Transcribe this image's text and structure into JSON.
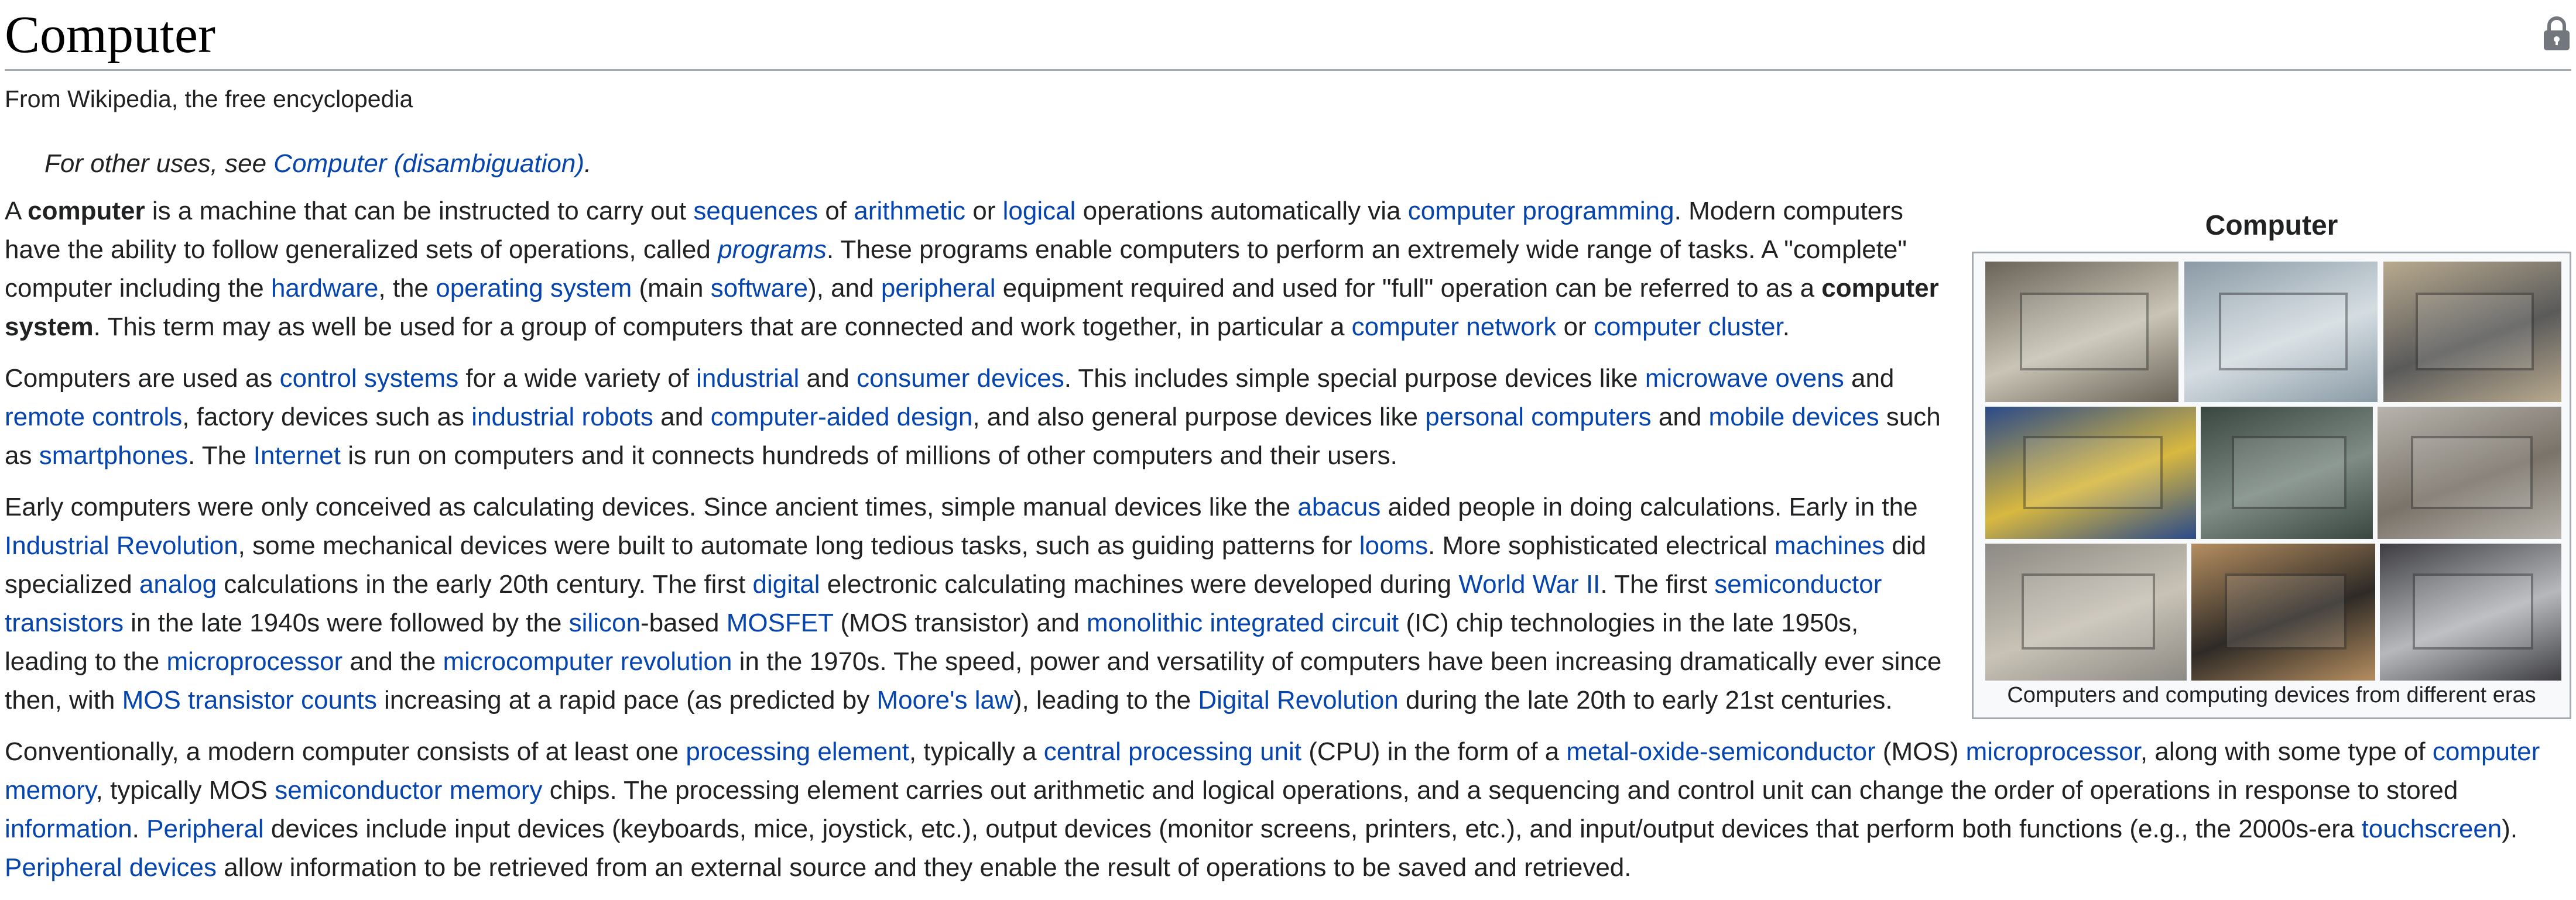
{
  "article": {
    "title": "Computer",
    "tagline": "From Wikipedia, the free encyclopedia",
    "hatnote": {
      "prefix": "For other uses, see ",
      "link": "Computer (disambiguation)",
      "suffix": "."
    }
  },
  "paragraphs": [
    {
      "wide": false,
      "segments": [
        {
          "t": "A ",
          "k": "text"
        },
        {
          "t": "computer",
          "k": "bold"
        },
        {
          "t": " is a machine that can be instructed to carry out ",
          "k": "text"
        },
        {
          "t": "sequences",
          "k": "link"
        },
        {
          "t": " of ",
          "k": "text"
        },
        {
          "t": "arithmetic",
          "k": "link"
        },
        {
          "t": " or ",
          "k": "text"
        },
        {
          "t": "logical",
          "k": "link"
        },
        {
          "t": " operations automatically via ",
          "k": "text"
        },
        {
          "t": "computer programming",
          "k": "link"
        },
        {
          "t": ". Modern computers have the ability to follow generalized sets of operations, called ",
          "k": "text"
        },
        {
          "t": "programs",
          "k": "italic-link"
        },
        {
          "t": ". These programs enable computers to perform an extremely wide range of tasks. A \"complete\" computer including the ",
          "k": "text"
        },
        {
          "t": "hardware",
          "k": "link"
        },
        {
          "t": ", the ",
          "k": "text"
        },
        {
          "t": "operating system",
          "k": "link"
        },
        {
          "t": " (main ",
          "k": "text"
        },
        {
          "t": "software",
          "k": "link"
        },
        {
          "t": "), and ",
          "k": "text"
        },
        {
          "t": "peripheral",
          "k": "link"
        },
        {
          "t": " equipment required and used for \"full\" operation can be referred to as a ",
          "k": "text"
        },
        {
          "t": "computer system",
          "k": "bold"
        },
        {
          "t": ". This term may as well be used for a group of computers that are connected and work together, in particular a ",
          "k": "text"
        },
        {
          "t": "computer network",
          "k": "link"
        },
        {
          "t": " or ",
          "k": "text"
        },
        {
          "t": "computer cluster",
          "k": "link"
        },
        {
          "t": ".",
          "k": "text"
        }
      ]
    },
    {
      "wide": false,
      "segments": [
        {
          "t": "Computers are used as ",
          "k": "text"
        },
        {
          "t": "control systems",
          "k": "link"
        },
        {
          "t": " for a wide variety of ",
          "k": "text"
        },
        {
          "t": "industrial",
          "k": "link"
        },
        {
          "t": " and ",
          "k": "text"
        },
        {
          "t": "consumer devices",
          "k": "link"
        },
        {
          "t": ". This includes simple special purpose devices like ",
          "k": "text"
        },
        {
          "t": "microwave ovens",
          "k": "link"
        },
        {
          "t": " and ",
          "k": "text"
        },
        {
          "t": "remote controls",
          "k": "link"
        },
        {
          "t": ", factory devices such as ",
          "k": "text"
        },
        {
          "t": "industrial robots",
          "k": "link"
        },
        {
          "t": " and ",
          "k": "text"
        },
        {
          "t": "computer-aided design",
          "k": "link"
        },
        {
          "t": ", and also general purpose devices like ",
          "k": "text"
        },
        {
          "t": "personal computers",
          "k": "link"
        },
        {
          "t": " and ",
          "k": "text"
        },
        {
          "t": "mobile devices",
          "k": "link"
        },
        {
          "t": " such as ",
          "k": "text"
        },
        {
          "t": "smartphones",
          "k": "link"
        },
        {
          "t": ". The ",
          "k": "text"
        },
        {
          "t": "Internet",
          "k": "link"
        },
        {
          "t": " is run on computers and it connects hundreds of millions of other computers and their users.",
          "k": "text"
        }
      ]
    },
    {
      "wide": false,
      "segments": [
        {
          "t": "Early computers were only conceived as calculating devices. Since ancient times, simple manual devices like the ",
          "k": "text"
        },
        {
          "t": "abacus",
          "k": "link"
        },
        {
          "t": " aided people in doing calculations. Early in the ",
          "k": "text"
        },
        {
          "t": "Industrial Revolution",
          "k": "link"
        },
        {
          "t": ", some mechanical devices were built to automate long tedious tasks, such as guiding patterns for ",
          "k": "text"
        },
        {
          "t": "looms",
          "k": "link"
        },
        {
          "t": ". More sophisticated electrical ",
          "k": "text"
        },
        {
          "t": "machines",
          "k": "link"
        },
        {
          "t": " did specialized ",
          "k": "text"
        },
        {
          "t": "analog",
          "k": "link"
        },
        {
          "t": " calculations in the early 20th century. The first ",
          "k": "text"
        },
        {
          "t": "digital",
          "k": "link"
        },
        {
          "t": " electronic calculating machines were developed during ",
          "k": "text"
        },
        {
          "t": "World War II",
          "k": "link"
        },
        {
          "t": ". The first ",
          "k": "text"
        },
        {
          "t": "semiconductor transistors",
          "k": "link"
        },
        {
          "t": " in the late 1940s were followed by the ",
          "k": "text"
        },
        {
          "t": "silicon",
          "k": "link"
        },
        {
          "t": "-based ",
          "k": "text"
        },
        {
          "t": "MOSFET",
          "k": "link"
        },
        {
          "t": " (MOS transistor) and ",
          "k": "text"
        },
        {
          "t": "monolithic integrated circuit",
          "k": "link"
        },
        {
          "t": " (IC) chip technologies in the late 1950s, leading to the ",
          "k": "text"
        },
        {
          "t": "microprocessor",
          "k": "link"
        },
        {
          "t": " and the ",
          "k": "text"
        },
        {
          "t": "microcomputer revolution",
          "k": "link"
        },
        {
          "t": " in the 1970s. The speed, power and versatility of computers have been increasing dramatically ever since then, with ",
          "k": "text"
        },
        {
          "t": "MOS transistor counts",
          "k": "link"
        },
        {
          "t": " increasing at a rapid pace (as predicted by ",
          "k": "text"
        },
        {
          "t": "Moore's law",
          "k": "link"
        },
        {
          "t": "), leading to the ",
          "k": "text"
        },
        {
          "t": "Digital Revolution",
          "k": "link"
        },
        {
          "t": " during the late 20th to early 21st centuries.",
          "k": "text"
        }
      ]
    },
    {
      "wide": true,
      "segments": [
        {
          "t": "Conventionally, a modern computer consists of at least one ",
          "k": "text"
        },
        {
          "t": "processing element",
          "k": "link"
        },
        {
          "t": ", typically a ",
          "k": "text"
        },
        {
          "t": "central processing unit",
          "k": "link"
        },
        {
          "t": " (CPU) in the form of a ",
          "k": "text"
        },
        {
          "t": "metal-oxide-semiconductor",
          "k": "link"
        },
        {
          "t": " (MOS) ",
          "k": "text"
        },
        {
          "t": "microprocessor",
          "k": "link"
        },
        {
          "t": ", along with some type of ",
          "k": "text"
        },
        {
          "t": "computer memory",
          "k": "link"
        },
        {
          "t": ", typically MOS ",
          "k": "text"
        },
        {
          "t": "semiconductor memory",
          "k": "link"
        },
        {
          "t": " chips. The processing element carries out arithmetic and logical operations, and a sequencing and control unit can change the order of operations in response to stored ",
          "k": "text"
        },
        {
          "t": "information",
          "k": "link"
        },
        {
          "t": ". ",
          "k": "text"
        },
        {
          "t": "Peripheral",
          "k": "link"
        },
        {
          "t": " devices include input devices (keyboards, mice, joystick, etc.), output devices (monitor screens, printers, etc.), and input/output devices that perform both functions (e.g., the 2000s-era ",
          "k": "text"
        },
        {
          "t": "touchscreen",
          "k": "link"
        },
        {
          "t": "). ",
          "k": "text"
        },
        {
          "t": "Peripheral devices",
          "k": "link"
        },
        {
          "t": " allow information to be retrieved from an external source and they enable the result of operations to be saved and retrieved.",
          "k": "text"
        }
      ]
    }
  ],
  "infobox": {
    "title": "Computer",
    "caption": "Computers and computing devices from different eras",
    "images": [
      {
        "name": "laptop-photo-icon",
        "bg": "#6a6358",
        "accent": "#c9c4b6"
      },
      {
        "name": "supercomputer-hall-photo-icon",
        "bg": "#8a9aa5",
        "accent": "#d5dde2"
      },
      {
        "name": "vintage-terminal-photo-icon",
        "bg": "#b9aa8f",
        "accent": "#5a5a5a"
      },
      {
        "name": "motherboard-photo-icon",
        "bg": "#2a4a8a",
        "accent": "#d8b840"
      },
      {
        "name": "server-cabinet-photo-icon",
        "bg": "#3a4640",
        "accent": "#7f8c86"
      },
      {
        "name": "tower-pc-photo-icon",
        "bg": "#b8b4ad",
        "accent": "#7a736a"
      },
      {
        "name": "mainframe-room-photo-icon",
        "bg": "#8d8a84",
        "accent": "#c8c2b6"
      },
      {
        "name": "home-computer-photo-icon",
        "bg": "#b58e60",
        "accent": "#2e2a26"
      },
      {
        "name": "rack-servers-photo-icon",
        "bg": "#3e3e42",
        "accent": "#b6b8bc"
      }
    ]
  }
}
